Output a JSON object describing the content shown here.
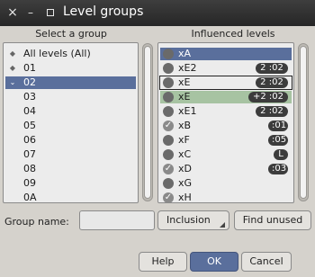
{
  "window": {
    "title": "Level groups"
  },
  "titlebar": {
    "close_icon": "×",
    "minimize_icon": "–"
  },
  "headers": {
    "select_group": "Select a group",
    "influenced_levels": "Influenced levels"
  },
  "groups": [
    {
      "label": "All levels (All)",
      "icon": "◆",
      "selected": false
    },
    {
      "label": "01",
      "icon": "◆",
      "selected": false
    },
    {
      "label": "02",
      "icon": "⌄",
      "selected": true
    },
    {
      "label": "03",
      "icon": "",
      "selected": false
    },
    {
      "label": "04",
      "icon": "",
      "selected": false
    },
    {
      "label": "05",
      "icon": "",
      "selected": false
    },
    {
      "label": "06",
      "icon": "",
      "selected": false
    },
    {
      "label": "07",
      "icon": "",
      "selected": false
    },
    {
      "label": "08",
      "icon": "",
      "selected": false
    },
    {
      "label": "09",
      "icon": "",
      "selected": false
    },
    {
      "label": "0A",
      "icon": "",
      "selected": false
    }
  ],
  "levels": [
    {
      "label": "xA",
      "state": "dot",
      "badge": "",
      "style": "selected"
    },
    {
      "label": "xE2",
      "state": "dot",
      "badge": "2 :02",
      "style": ""
    },
    {
      "label": "xE",
      "state": "dot",
      "badge": "2 :02",
      "style": "focused"
    },
    {
      "label": "xE",
      "state": "dot",
      "badge": "+2 :02",
      "style": "green"
    },
    {
      "label": "xE1",
      "state": "dot",
      "badge": "2 :02",
      "style": ""
    },
    {
      "label": "xB",
      "state": "check",
      "badge": ":01",
      "style": ""
    },
    {
      "label": "xF",
      "state": "dot",
      "badge": ":05",
      "style": ""
    },
    {
      "label": "xC",
      "state": "dot",
      "badge": "L",
      "style": ""
    },
    {
      "label": "xD",
      "state": "check",
      "badge": ":03",
      "style": ""
    },
    {
      "label": "xG",
      "state": "dot",
      "badge": "",
      "style": ""
    },
    {
      "label": "xH",
      "state": "check",
      "badge": "",
      "style": ""
    }
  ],
  "bottom": {
    "group_name_label": "Group name:",
    "group_name_value": "",
    "inclusion_label": "Inclusion",
    "find_unused_label": "Find unused"
  },
  "buttons": {
    "help": "Help",
    "ok": "OK",
    "cancel": "Cancel"
  },
  "colors": {
    "selection": "#5a6f9c",
    "green_row": "#a7c3a2",
    "window_bg": "#d5d2cc"
  }
}
